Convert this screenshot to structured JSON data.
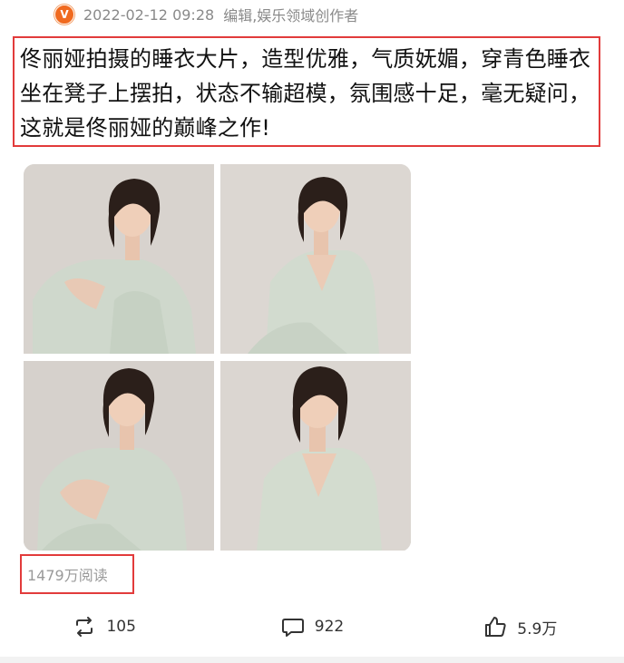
{
  "meta": {
    "verified_badge": "V",
    "time": "2022-02-12 09:28",
    "source": "编辑,娱乐领域创作者"
  },
  "post": {
    "text": "佟丽娅拍摄的睡衣大片，造型优雅，气质妩媚，穿青色睡衣坐在凳子上摆拍，状态不输超模，氛围感十足，毫无疑问，这就是佟丽娅的巅峰之作!"
  },
  "gallery": {
    "count": 4
  },
  "stats": {
    "reads": "1479万阅读"
  },
  "actions": {
    "repost_count": "105",
    "comment_count": "922",
    "like_count": "5.9万"
  },
  "colors": {
    "highlight_border": "#e23b3b",
    "verified_badge": "#f06a1f",
    "muted_text": "#8a8a8a"
  }
}
